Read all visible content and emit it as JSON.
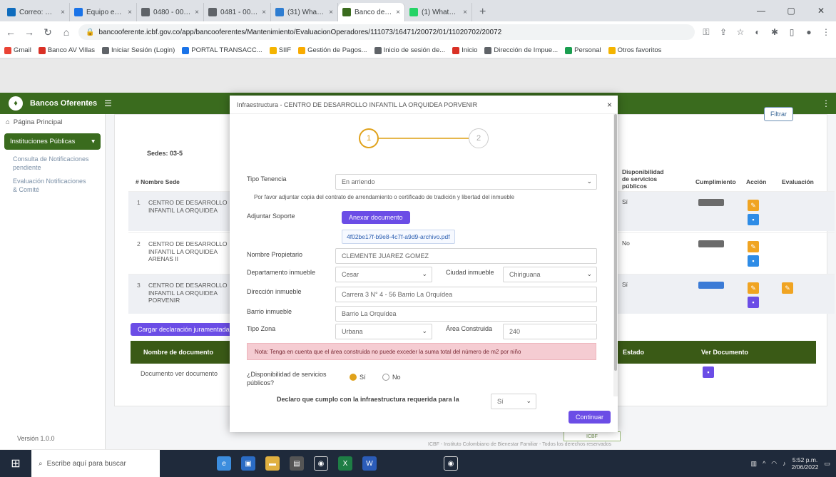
{
  "browser": {
    "tabs": [
      {
        "title": "Correo: Claudia I",
        "color": "#0f6cbd",
        "active": false
      },
      {
        "title": "Equipo evaluado",
        "color": "#1a73e8",
        "active": false
      },
      {
        "title": "0480 - 00590151",
        "color": "#5f6368",
        "active": false
      },
      {
        "title": "0481 - 00591051",
        "color": "#5f6368",
        "active": false
      },
      {
        "title": "(31) WhatsApp",
        "color": "#2e7dd1",
        "active": false
      },
      {
        "title": "Banco de Oferen",
        "color": "#3a6b1e",
        "active": true
      },
      {
        "title": "(1) WhatsApp",
        "color": "#25d366",
        "active": false
      }
    ],
    "url": "bancooferente.icbf.gov.co/app/bancooferentes/Mantenimiento/EvaluacionOperadores/111073/16471/20072/01/11020702/20072",
    "bookmarks": [
      "Gmail",
      "Banco AV Villas",
      "Iniciar Sesión (Login)",
      "PORTAL TRANSACC...",
      "SIIF",
      "Gestión de Pagos...",
      "Inicio de sesión de...",
      "Inicio",
      "Dirección de Impue...",
      "Personal",
      "Otros favoritos"
    ]
  },
  "app": {
    "title": "Bancos Oferentes",
    "sidebar": {
      "home": "Página Principal",
      "active": "Instituciones Públicas",
      "subitems": [
        "Consulta de Notificaciones pendiente",
        "Evaluación Notificaciones & Comité"
      ],
      "footer": "Versión 1.0.0"
    },
    "page": {
      "filter_label": "Filtrar",
      "section_label": "Sedes: 03-5",
      "col_number": "# Nombre Sede",
      "col_capacity": "Disponibilidad de servicios públicos",
      "col_status": "Cumplimiento",
      "col_actions": "Acción",
      "col_eval": "Evaluación",
      "rows": [
        {
          "num": "1",
          "name": "CENTRO DE DESARROLLO INFANTIL LA ORQUIDEA",
          "cap": "Sí"
        },
        {
          "num": "2",
          "name": "CENTRO DE DESARROLLO INFANTIL LA ORQUIDEA ARENAS II",
          "cap": "No"
        },
        {
          "num": "3",
          "name": "CENTRO DE DESARROLLO INFANTIL LA ORQUIDEA PORVENIR",
          "cap": "Sí"
        }
      ],
      "upload_button": "Cargar declaración juramentada",
      "doc_header_name": "Nombre de documento",
      "doc_header_status": "Estado",
      "doc_header_view": "Ver Documento",
      "doc_row": "Documento ver documento"
    },
    "modal": {
      "title": "Infraestructura - CENTRO DE DESARROLLO INFANTIL LA ORQUIDEA PORVENIR",
      "step1": "1",
      "step2": "2",
      "tipo_tenencia_label": "Tipo Tenencia",
      "tipo_tenencia_value": "En arriendo",
      "helper": "Por favor adjuntar copia del contrato de arrendamiento o certificado de tradición y libertad del inmueble",
      "adjuntar_label": "Adjuntar Soporte",
      "adjuntar_button": "Anexar documento",
      "doc_link": "4f02be17f-b9e8-4c7f-a9d9-archivo.pdf",
      "propietario_label": "Nombre Propietario",
      "propietario_value": "CLEMENTE JUAREZ GOMEZ",
      "depto_label": "Departamento inmueble",
      "depto_value": "Cesar",
      "ciudad_label": "Ciudad inmueble",
      "ciudad_value": "Chiriguana",
      "direccion_label": "Dirección inmueble",
      "direccion_value": "Carrera 3 N° 4 - 56 Barrio La Orquídea",
      "barrio_label": "Barrio inmueble",
      "barrio_value": "Barrio La Orquídea",
      "zona_label": "Tipo Zona",
      "zona_value": "Urbana",
      "area_label": "Área Construida",
      "area_value": "240",
      "alert": "Nota: Tenga en cuenta que el área construida no puede exceder la suma total del número de m2 por niño",
      "disp_label": "¿Disponibilidad de servicios públicos?",
      "radio_si": "Sí",
      "radio_no": "No",
      "declara_label": "Declaro que cumplo con la infraestructura requerida para la",
      "declara_value": "Sí",
      "continuar": "Continuar"
    },
    "footer_note": "ICBF - Instituto Colombiano de Bienestar Familiar - Todos los derechos reservados"
  },
  "taskbar": {
    "search_placeholder": "Escribe aquí para buscar",
    "time": "5:52 p.m.",
    "date": "2/06/2022"
  }
}
